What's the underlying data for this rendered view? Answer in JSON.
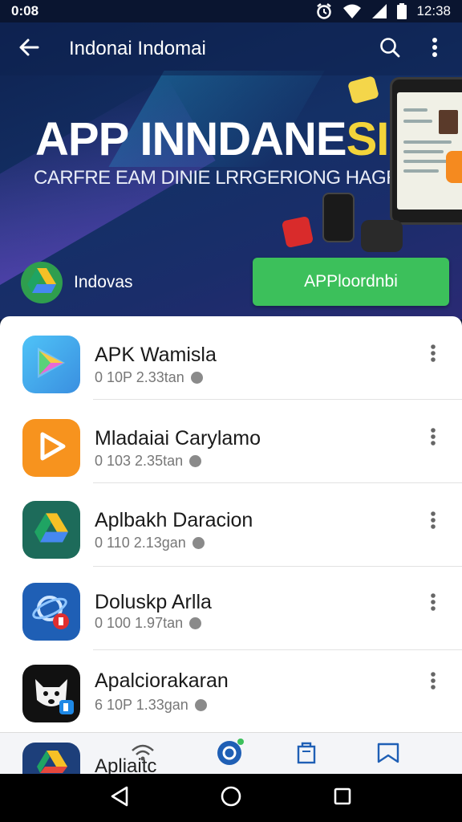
{
  "status_bar": {
    "time_left": "0:08",
    "time_right": "12:38"
  },
  "app_bar": {
    "title": "Indonai Indomai"
  },
  "hero": {
    "headline_main": "APP INNDANE",
    "headline_accent": "SIA",
    "subline": "CARFRE EAM DINIE LRRGERIONG HAGR",
    "featured_label": "Indovas",
    "cta_label": "APPloordnbi"
  },
  "apps": [
    {
      "title": "APK Wamisla",
      "meta": "0 10P  2.33tan",
      "icon": "play-store-icon",
      "color": "#3ab0f0"
    },
    {
      "title": "Mladaiai Carylamo",
      "meta": "0 103  2.35tan",
      "icon": "play-arrow-icon",
      "color": "#f7931e"
    },
    {
      "title": "Aplbakh Daracion",
      "meta": "0 110  2.13gan",
      "icon": "drive-icon",
      "color": "#1d6b5a"
    },
    {
      "title": "Doluskp Arlla",
      "meta": "0 100  1.97tan",
      "icon": "orbit-icon",
      "color": "#1f5fb5"
    },
    {
      "title": "Apalciorakaran",
      "meta": "6 10P  1.33gan",
      "icon": "dog-face-icon",
      "color": "#111111"
    }
  ],
  "bottom_nav": {
    "partial_title": "Apliaitc"
  },
  "colors": {
    "accent_green": "#3cc05b",
    "hero_bg": "#143066",
    "accent_yellow": "#f3d43a"
  }
}
